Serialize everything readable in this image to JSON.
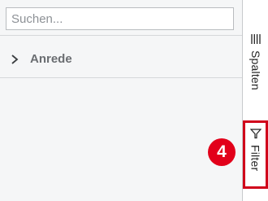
{
  "search": {
    "placeholder": "Suchen...",
    "value": ""
  },
  "groups": [
    {
      "label": "Anrede",
      "icon": "chevron-right-icon"
    }
  ],
  "sidebar": {
    "columns_tab": {
      "label": "Spalten",
      "icon": "columns-icon"
    },
    "filter_tab": {
      "label": "Filter",
      "icon": "filter-icon"
    }
  },
  "annotation": {
    "step_number": "4",
    "color": "#e2001a"
  },
  "colors": {
    "panel_bg": "#f5f6f7",
    "highlight_border": "#d0021b",
    "label_gray": "#6a6d71"
  }
}
